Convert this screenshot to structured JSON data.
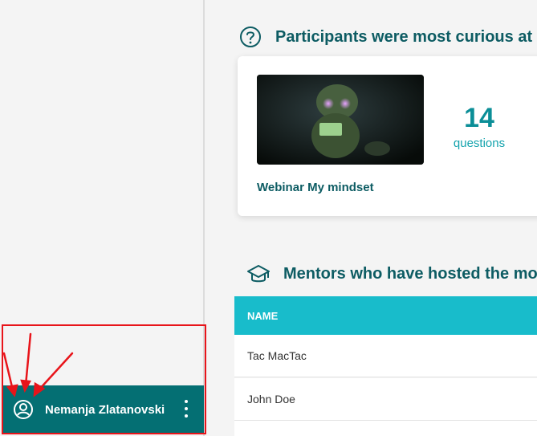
{
  "sidebar": {
    "user": {
      "name": "Nemanja Zlatanovski",
      "avatar_icon": "user-circle-icon",
      "menu_icon": "more-vertical-icon"
    }
  },
  "main": {
    "curious_section": {
      "icon": "question-circle-icon",
      "title": "Participants were most curious at",
      "card": {
        "webinar_title": "Webinar My mindset",
        "question_count": "14",
        "question_label": "questions"
      }
    },
    "mentors_section": {
      "icon": "graduation-cap-icon",
      "title": "Mentors who have hosted the mo",
      "table": {
        "columns": [
          "NAME"
        ],
        "rows": [
          {
            "name": "Tac MacTac"
          },
          {
            "name": "John Doe"
          }
        ]
      }
    }
  },
  "colors": {
    "accent_dark": "#046f73",
    "accent_teal": "#18bccb",
    "title_text": "#0d5c63",
    "annotation_red": "#e8141a"
  }
}
